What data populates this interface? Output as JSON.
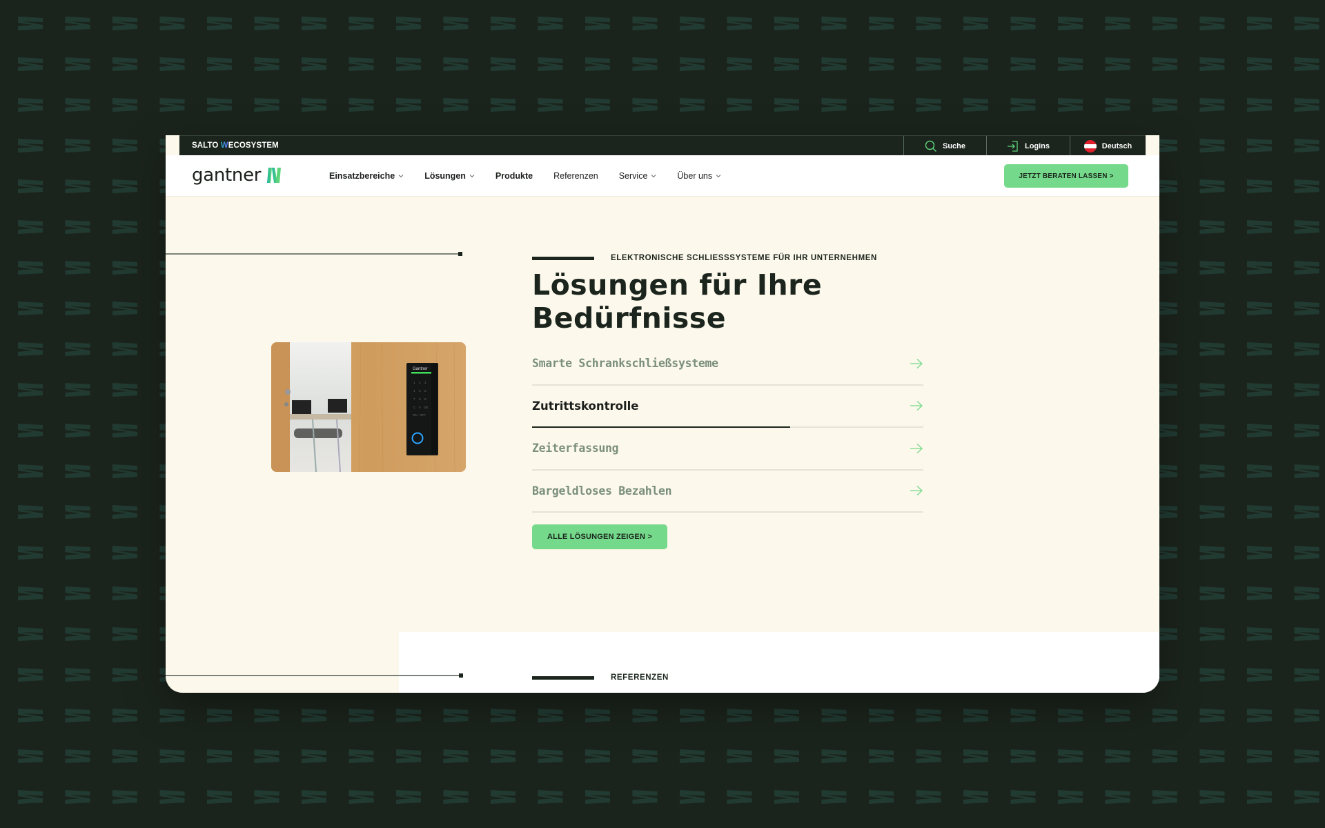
{
  "topbar": {
    "brand_prefix": "SALTO ",
    "brand_w": "W",
    "brand_suffix": "ECOSYSTEM",
    "search_label": "Suche",
    "logins_label": "Logins",
    "language_label": "Deutsch"
  },
  "header": {
    "logo_text": "gantner",
    "nav": [
      {
        "label": "Einsatzbereiche",
        "has_dropdown": true
      },
      {
        "label": "Lösungen",
        "has_dropdown": true
      },
      {
        "label": "Produkte",
        "has_dropdown": false
      },
      {
        "label": "Referenzen",
        "has_dropdown": false
      },
      {
        "label": "Service",
        "has_dropdown": true
      },
      {
        "label": "Über uns",
        "has_dropdown": true
      }
    ],
    "cta_label": "JETZT BERATEN LASSEN >"
  },
  "hero": {
    "eyebrow": "ELEKTRONISCHE SCHLIESSSYSTEME FÜR IHR UNTERNEHMEN",
    "title_bold": "Lösungen",
    "title_rest_line1": " für Ihre",
    "title_line2": "Bedürfnisse",
    "image_alt": "Gantner Zutrittskontrolle Keypad an Holztür",
    "device_brand": "Gantner",
    "keypad_keys": [
      "1",
      "2",
      "3",
      "4",
      "5",
      "6",
      "7",
      "8",
      "9",
      "C",
      "0",
      "OK",
      "ON",
      "OFF"
    ],
    "solutions": [
      {
        "label": "Smarte Schrankschließsysteme",
        "active": false
      },
      {
        "label": "Zutrittskontrolle",
        "active": true,
        "progress": 0.66
      },
      {
        "label": "Zeiterfassung",
        "active": false
      },
      {
        "label": "Bargeldloses Bezahlen",
        "active": false
      }
    ],
    "all_button_label": "ALLE LÖSUNGEN ZEIGEN >"
  },
  "next_section": {
    "eyebrow": "REFERENZEN"
  },
  "colors": {
    "background": "#1b241c",
    "accent_green": "#74d98a",
    "cream": "#fdf8ec",
    "dark": "#1b251d",
    "muted_item": "#7a8f7c"
  }
}
